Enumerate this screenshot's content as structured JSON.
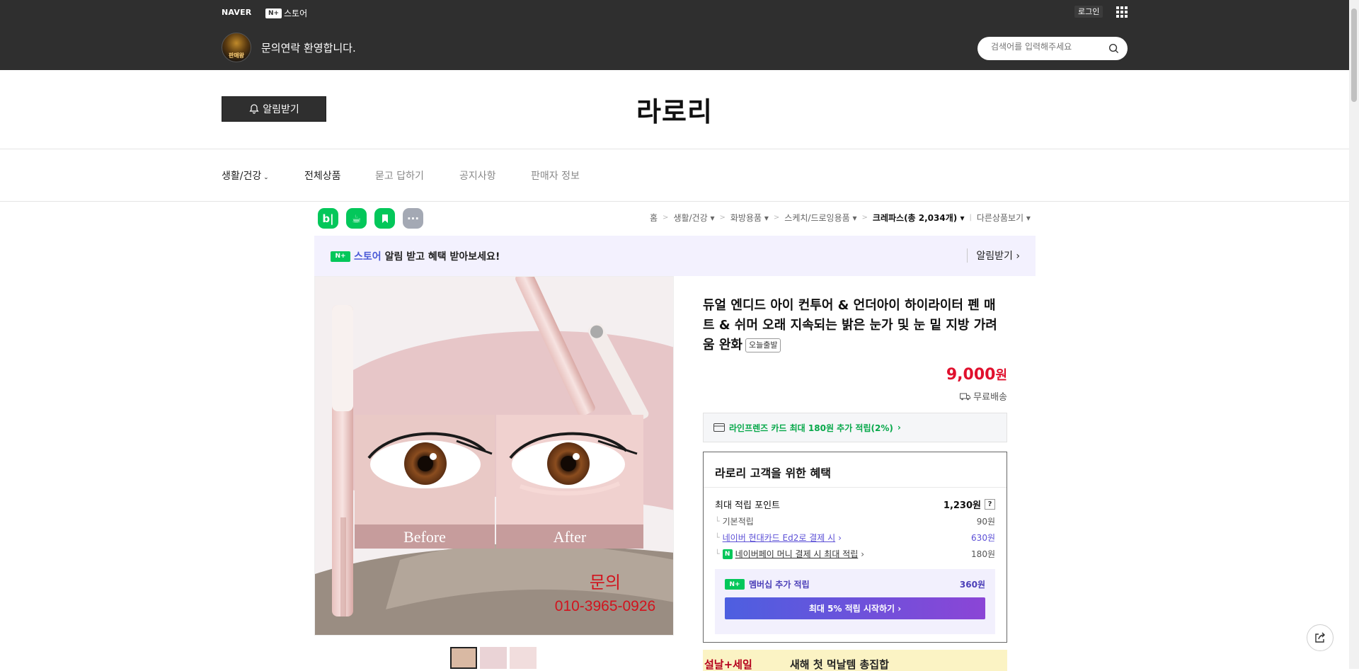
{
  "gnb": {
    "naver_logo": "NAVER",
    "store_logo_mark": "N+",
    "store_logo_text": "스토어",
    "login_label": "로그인",
    "apps_icon": "grid-icon"
  },
  "store": {
    "avatar_text": "판매왕",
    "welcome": "문의연락 환영합니다.",
    "search_placeholder": "검색어를 입력해주세요",
    "alarm_label": "알림받기",
    "name": "라로리"
  },
  "category_nav": {
    "items": [
      {
        "label": "생활/건강"
      },
      {
        "label": "전체상품"
      },
      {
        "label": "묻고 답하기"
      },
      {
        "label": "공지사항"
      },
      {
        "label": "판매자 정보"
      }
    ]
  },
  "sns": [
    {
      "name": "blog",
      "label": "b|",
      "color": "#03c75a"
    },
    {
      "name": "cafe",
      "label": "☕",
      "color": "#03c75a"
    },
    {
      "name": "bookmark",
      "label": "",
      "color": "#03c75a"
    },
    {
      "name": "more",
      "label": "···",
      "color": "#a4a9b4"
    }
  ],
  "breadcrumb": {
    "home": "홈",
    "c1": "생활/건강",
    "c2": "화방용품",
    "c3": "스케치/드로잉용품",
    "c4": "크레파스(총 2,034개)",
    "other": "다른상품보기"
  },
  "alarm_banner": {
    "store_mark": "N+",
    "store_word": "스토어",
    "text": "알림 받고 혜택 받아보세요!",
    "action": "알림받기"
  },
  "product": {
    "title": "듀얼 엔디드 아이 컨투어 & 언더아이 하이라이터 펜 매트 & 쉬머 오래 지속되는 밝은 눈가 및 눈 밑 지방 가려움 완화",
    "tag": "오늘출발",
    "price_number": "9,000",
    "price_unit": "원",
    "shipping": "무료배송",
    "card_offer": "라인프렌즈 카드 최대 180원 추가 적립(2%)",
    "image": {
      "before_label": "Before",
      "after_label": "After",
      "contact_title": "문의",
      "contact_phone": "010-3965-0926"
    }
  },
  "benefits": {
    "title": "라로리 고객을 위한 혜택",
    "max_points_label": "최대 적립 포인트",
    "max_points_value": "1,230원",
    "help": "?",
    "rows": [
      {
        "label": "기본적립",
        "value": "90원"
      },
      {
        "label": "네이버 현대카드 Ed2로 결제 시",
        "value": "630원"
      },
      {
        "label": "네이버페이 머니 결제 시 최대 적립",
        "value": "180원"
      }
    ],
    "membership_label": "멤버십 추가 적립",
    "membership_value": "360원",
    "membership_cta": "최대 5% 적립 시작하기 ›"
  },
  "promo": {
    "left": "설날+세일",
    "right": "새해 첫 먹날템 총집합"
  },
  "colors": {
    "dark_bar": "#2f2f2f",
    "price": "#e0102d",
    "green": "#03c75a",
    "purple": "#5b4fd6"
  }
}
